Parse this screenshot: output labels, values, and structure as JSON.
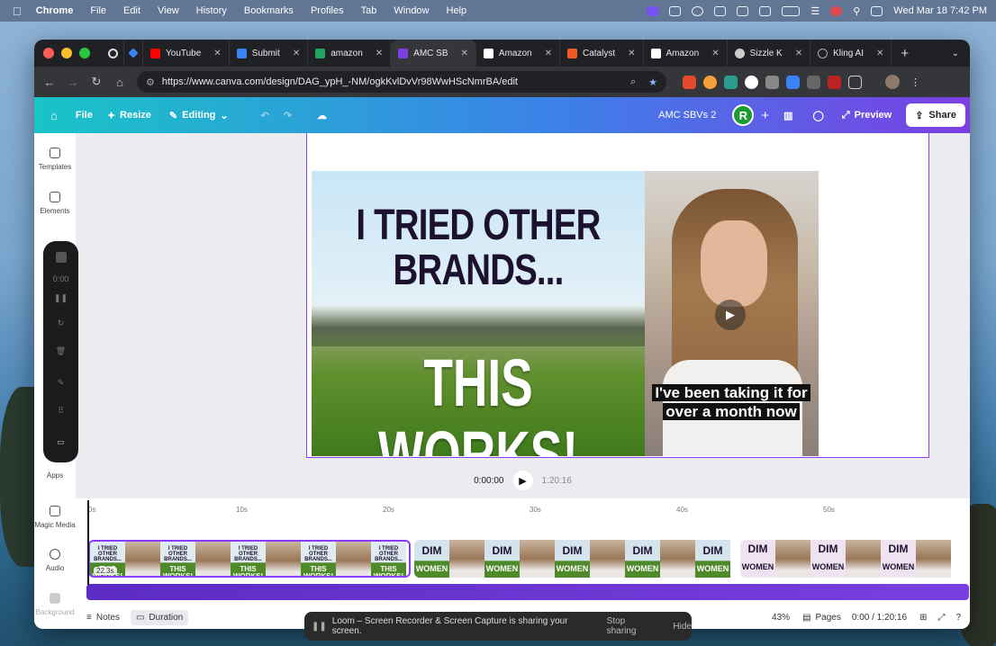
{
  "menubar": {
    "app": "Chrome",
    "items": [
      "File",
      "Edit",
      "View",
      "History",
      "Bookmarks",
      "Profiles",
      "Tab",
      "Window",
      "Help"
    ],
    "clock": "Wed Mar 18  7:42 PM"
  },
  "browser": {
    "tabs": [
      {
        "label": "YouTube",
        "color": "#ff0000"
      },
      {
        "label": "Submit",
        "color": "#3b82f6"
      },
      {
        "label": "amazon",
        "color": "#1fa463"
      },
      {
        "label": "AMC SB",
        "color": "#7b3fe4",
        "active": true
      },
      {
        "label": "Amazon",
        "color": "#ffffff"
      },
      {
        "label": "Catalyst",
        "color": "#f15a24"
      },
      {
        "label": "Amazon",
        "color": "#ffffff"
      },
      {
        "label": "Sizzle K",
        "color": "#cccccc"
      },
      {
        "label": "Kling AI",
        "color": "#888888"
      }
    ],
    "url": "https://www.canva.com/design/DAG_ypH_-NM/ogkKvlDvVr98WwHScNmrBA/edit"
  },
  "canva": {
    "file": "File",
    "resize": "Resize",
    "editing": "Editing",
    "title": "AMC SBVs 2",
    "avatar": "R",
    "preview": "Preview",
    "share": "Share",
    "sidebar": {
      "templates": "Templates",
      "elements": "Elements",
      "apps": "Apps",
      "magic_media": "Magic Media",
      "audio": "Audio",
      "background": "Background"
    },
    "recorder_time": "0:00",
    "design": {
      "headline_top": "I TRIED OTHER BRANDS...",
      "headline_bottom": "THIS WORKS!",
      "caption_line1": "I've been taking it for",
      "caption_line2": "over a month now"
    },
    "playback": {
      "current": "0:00:00",
      "total": "1:20:16"
    },
    "ruler": [
      "0s",
      "10s",
      "20s",
      "30s",
      "40s",
      "50s"
    ],
    "clips": {
      "clip1_duration": "22.3s",
      "a_top": "I TRIED OTHER BRANDS...",
      "a_bottom": "THIS WORKS!",
      "d_top": "DIM",
      "d_bottom": "WOMEN"
    },
    "footer": {
      "notes": "Notes",
      "duration": "Duration",
      "zoom": "43%",
      "pages": "Pages",
      "time": "0:00 / 1:20:16"
    }
  },
  "loom": {
    "message": "Loom – Screen Recorder & Screen Capture is sharing your screen.",
    "stop": "Stop sharing",
    "hide": "Hide"
  },
  "colors": {
    "canva_purple": "#8b3dff",
    "headline_dark": "#1c1230"
  }
}
